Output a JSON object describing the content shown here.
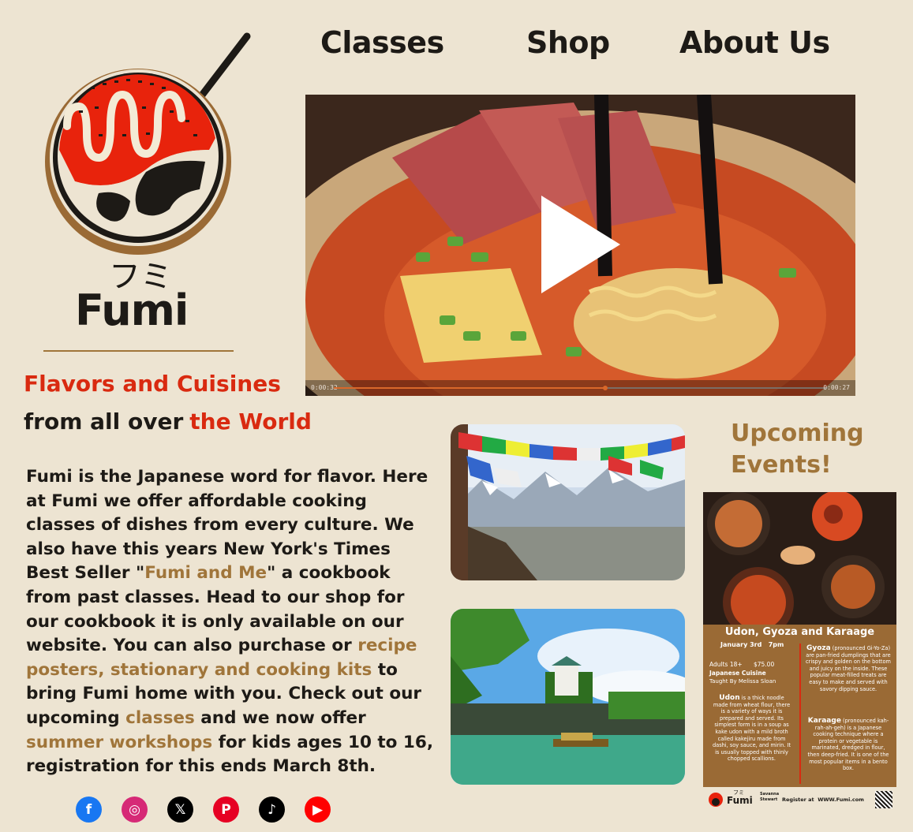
{
  "nav": {
    "classes": "Classes",
    "shop": "Shop",
    "about": "About Us"
  },
  "brand": {
    "jp": "フミ",
    "name": "Fumi"
  },
  "tagline": {
    "line1": "Flavors and Cuisines",
    "line2_a": "from all over",
    "line2_b": "the World"
  },
  "video": {
    "current_time": "0:00:32",
    "total_time": "0:00:27",
    "progress": 0.55
  },
  "intro": {
    "p1": "Fumi is the Japanese word for flavor. Here at Fumi we offer affordable cooking classes of dishes from every culture. We also have this years New York's Times Best Seller \"",
    "book": "Fumi and Me",
    "p2": "\" a cookbook from past classes. Head to our shop for our cookbook it is only available on our website. You can also purchase or ",
    "link1": "recipe posters, stationary and cooking kits",
    "p3": " to bring Fumi home with you. Check out our upcoming ",
    "link2": "classes",
    "p4": " and we now offer ",
    "link3": "summer workshops",
    "p5": " for kids ages 10 to 16, registration for this ends March 8th."
  },
  "events": {
    "title_1": "Upcoming",
    "title_2": "Events!"
  },
  "poster": {
    "title": "Udon, Gyoza and Karaage",
    "date": "January 3rd",
    "time": "7pm",
    "age": "Adults 18+",
    "price": "$75.00",
    "cuisine": "Japanese Cuisine",
    "teacher": "Taught By Melissa Sloan",
    "udon_h": "Udon",
    "udon_t": "is a thick noodle made from wheat flour, there is a variety of ways it is prepared and served. Its simplest form is in a soup as kake udon with a mild broth called kakejiru made from dashi, soy sauce, and mirin. It is usually topped with thinly chopped scallions.",
    "gyoza_h": "Gyoza",
    "gyoza_p": "(pronounced Gi-Yo-Za)",
    "gyoza_t": "are pan-fried dumplings that are crispy and golden on the bottom and juicy on the inside. These popular meat-filled treats are easy to make and served with savory dipping sauce.",
    "karaage_h": "Karaage",
    "karaage_p": "(pronounced kah-rah-ah-geh)",
    "karaage_t": "is a Japanese cooking technique where a protein or vegetable is marinated, dredged in flour, then deep-fried. It is one of the most popular items in a bento box.",
    "foot_brand": "Fumi",
    "foot_jp": "フミ",
    "foot_name_1": "Savanna",
    "foot_name_2": "Stewart",
    "foot_register": "Register at",
    "foot_url": "WWW.Fumi.com"
  },
  "social": [
    {
      "name": "facebook",
      "glyph": "f",
      "color": "#1877f2"
    },
    {
      "name": "instagram",
      "glyph": "◎",
      "color": "#d62976"
    },
    {
      "name": "x",
      "glyph": "𝕏",
      "color": "#000000"
    },
    {
      "name": "pinterest",
      "glyph": "P",
      "color": "#e60023"
    },
    {
      "name": "tiktok",
      "glyph": "♪",
      "color": "#000000"
    },
    {
      "name": "youtube",
      "glyph": "▶",
      "color": "#ff0000"
    }
  ],
  "colors": {
    "bg": "#ede4d2",
    "accent_red": "#d92a10",
    "accent_brown": "#a0753a",
    "text": "#1d1a16"
  }
}
